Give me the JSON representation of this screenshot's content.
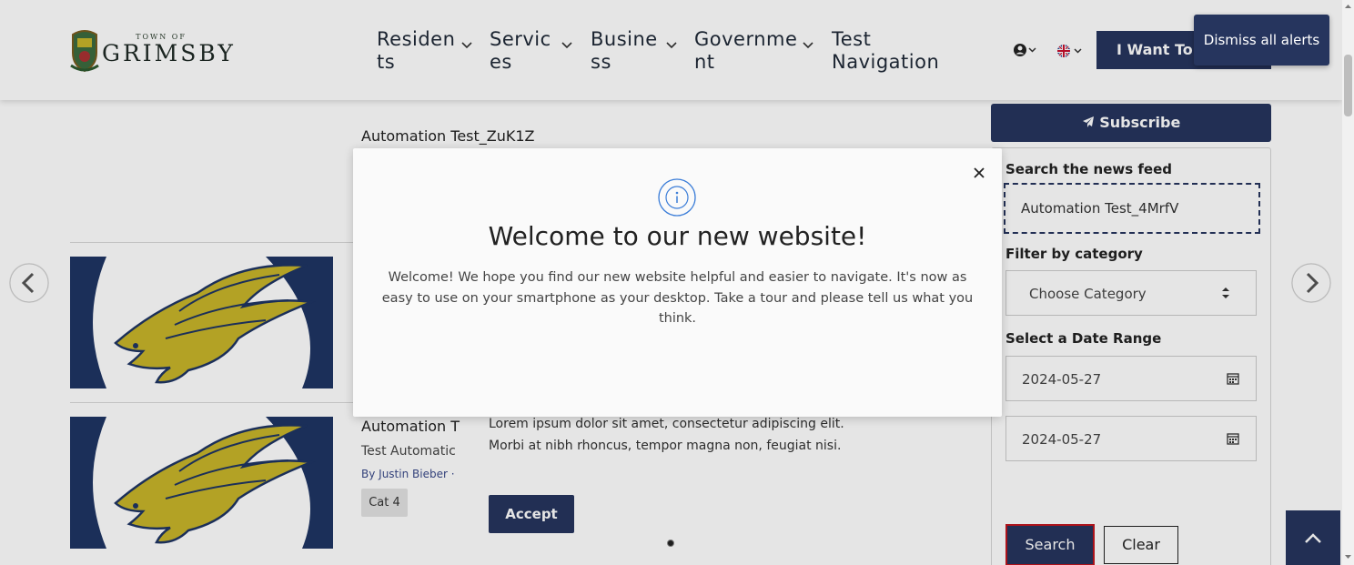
{
  "header": {
    "logo": {
      "town_of": "TOWN OF",
      "name": "GRIMSBY"
    },
    "nav": [
      {
        "line1": "Residen",
        "line2": "ts"
      },
      {
        "line1": "Servic",
        "line2": "es"
      },
      {
        "line1": "Busine",
        "line2": "ss"
      },
      {
        "line1": "Governme",
        "line2": "nt"
      },
      {
        "line1": "Test",
        "line2": "Navigation"
      }
    ],
    "want_button": "I Want To T",
    "dismiss_alerts": "Dismiss all alerts"
  },
  "main": {
    "top_item_title": "Automation Test_ZuK1Z",
    "item2": {
      "title": "Automation T",
      "subtitle": "Test Automatic",
      "byline": "By Justin Bieber ·",
      "tag": "Cat 4"
    }
  },
  "cookie": {
    "text": "Lorem ipsum dolor sit amet, consectetur adipiscing elit. Morbi at nibh rhoncus, tempor magna non, feugiat nisi.",
    "accept_label": "Accept"
  },
  "sidebar": {
    "subscribe_label": "Subscribe",
    "search_label": "Search the news feed",
    "search_value": "Automation Test_4MrfV",
    "category_label": "Filter by category",
    "category_selected": "Choose Category",
    "date_label": "Select a Date Range",
    "date_from": "2024-05-27",
    "date_to": "2024-05-27",
    "search_button": "Search",
    "clear_button": "Clear"
  },
  "modal": {
    "title": "Welcome to our new website!",
    "body": "Welcome! We hope you find our new website helpful and easier to navigate. It's now as easy to use on your smartphone as your desktop. Take a tour and please tell us what you think."
  },
  "colors": {
    "primary": "#26355e",
    "eagle_gold": "#c8b52a",
    "focus_red": "#c0161f"
  }
}
